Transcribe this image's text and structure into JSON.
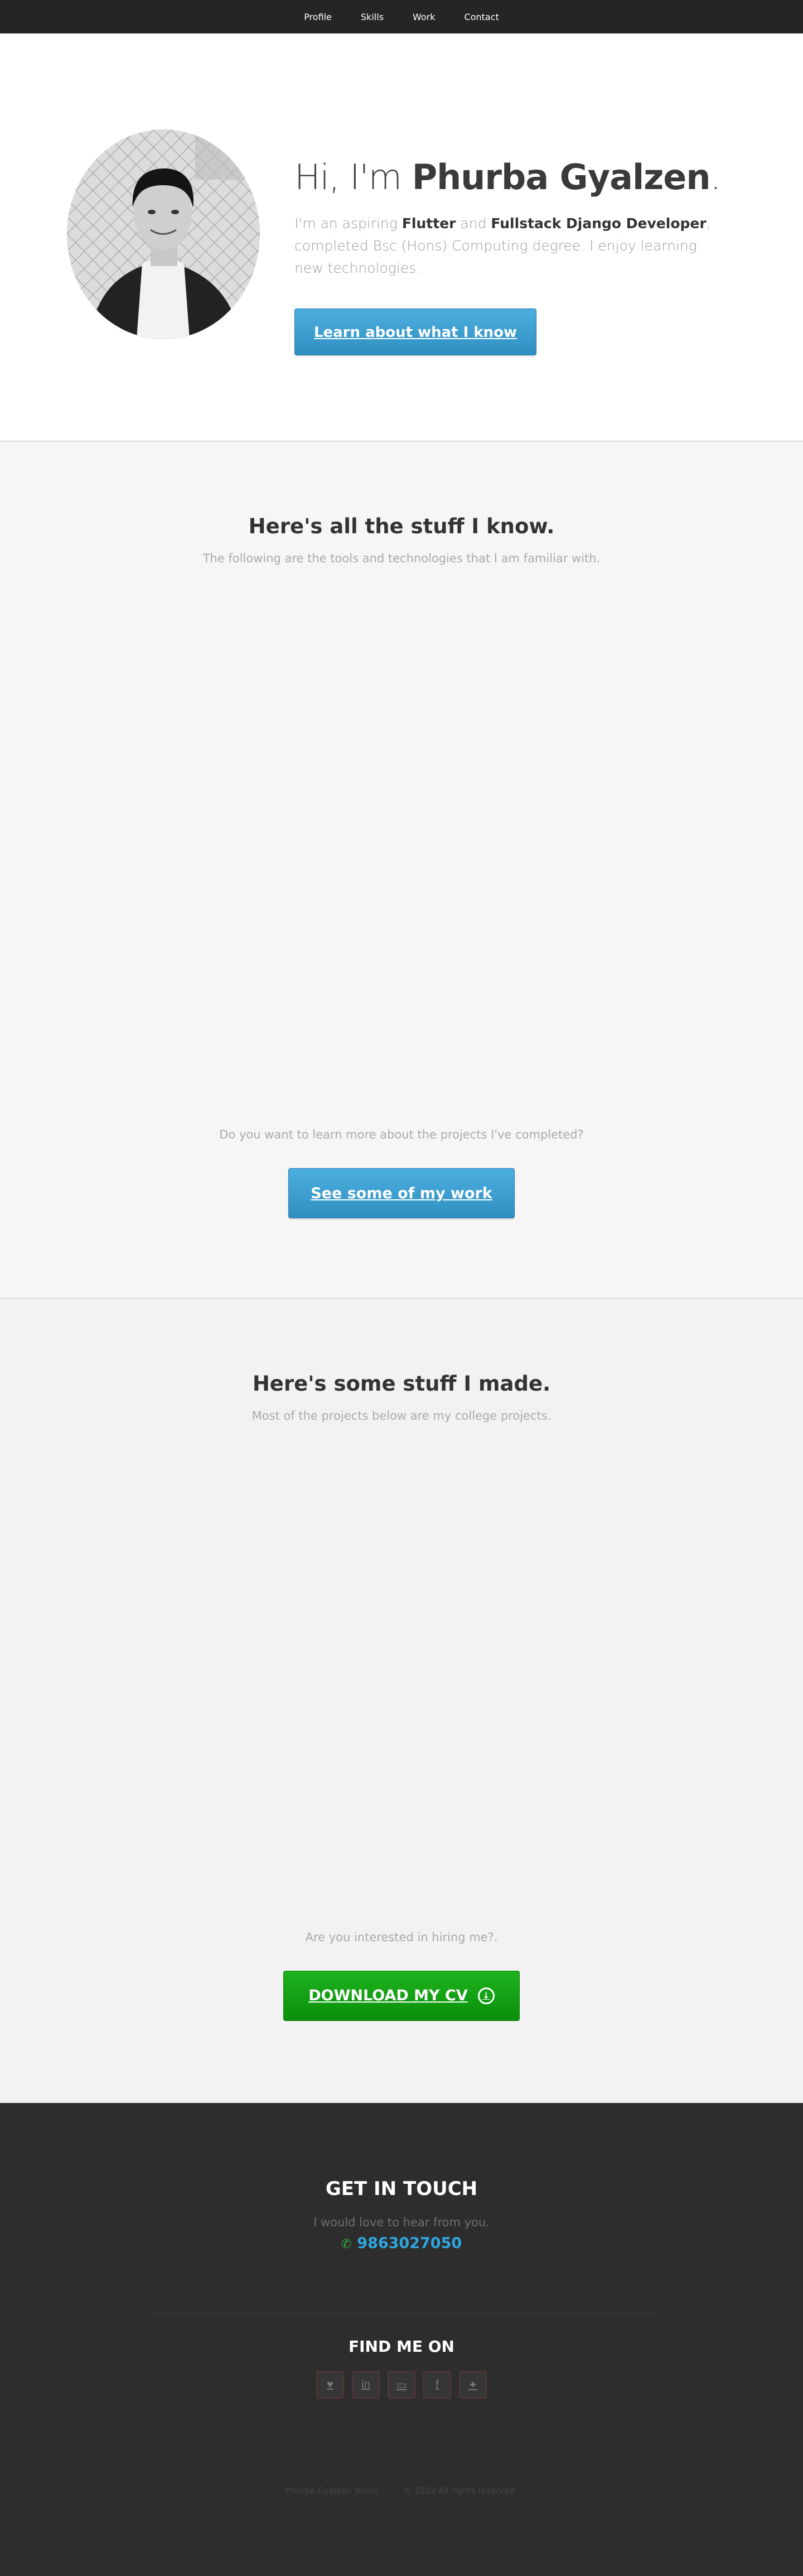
{
  "nav": {
    "items": [
      "Profile",
      "Skills",
      "Work",
      "Contact"
    ]
  },
  "hero": {
    "greeting": "Hi, I'm ",
    "name": "Phurba Gyalzen",
    "period": ".",
    "desc_1": "I'm an aspiring ",
    "flutter": "Flutter",
    "desc_and": " and ",
    "django": "Fullstack Django Developer",
    "desc_2": ", completed Bsc (Hons) Computing degree. I enjoy learning new technologies.",
    "button": "Learn about what I know"
  },
  "skills": {
    "title": "Here's all the stuff I know.",
    "subtitle": "The following are the tools and technologies that I am familiar with.",
    "ask": "Do you want to learn more about the projects I've completed?",
    "button": "See some of my work"
  },
  "work": {
    "title": "Here's some stuff I made.",
    "subtitle": "Most of the projects below are my college projects.",
    "ask": "Are you interested in hiring me?.",
    "button": "DOWNLOAD MY CV",
    "button_icon": "download-icon"
  },
  "footer": {
    "get_in_touch": "GET IN TOUCH",
    "love": "I would love to hear from you.",
    "phone": "9863027050",
    "phone_icon": "phone-icon",
    "find_me": "FIND ME ON",
    "socials": [
      "heart-icon",
      "linkedin-icon",
      "laptop-icon",
      "facebook-icon",
      "twitter-icon"
    ],
    "copyright_name": "Phurba Gyalzen Yolmo",
    "copyright_text": "© 2022 All rights reserved."
  },
  "colors": {
    "nav_bg": "#252525",
    "accent_blue": "#3a9ccf",
    "accent_green": "#12a012",
    "footer_bg": "#2d2d2d"
  }
}
